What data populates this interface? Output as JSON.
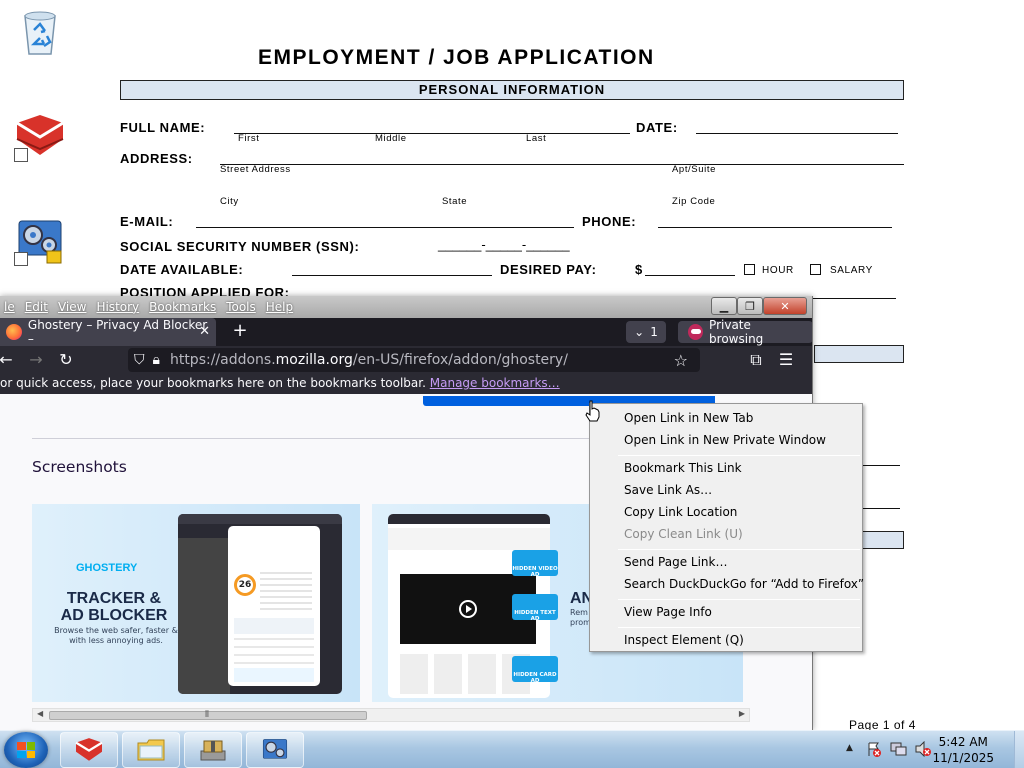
{
  "desktop": {
    "icons": [
      {
        "name": "recycle-bin"
      },
      {
        "name": "app-shortcut-red"
      },
      {
        "name": "settings-shortcut"
      }
    ]
  },
  "document": {
    "title": "EMPLOYMENT / JOB APPLICATION",
    "section": "PERSONAL INFORMATION",
    "full_name_label": "FULL NAME:",
    "first": "First",
    "middle": "Middle",
    "last": "Last",
    "date_label": "DATE:",
    "address_label": "ADDRESS:",
    "street": "Street Address",
    "apt": "Apt/Suite",
    "city": "City",
    "state": "State",
    "zip": "Zip Code",
    "email_label": "E-MAIL:",
    "phone_label": "PHONE:",
    "ssn_label": "SOCIAL SECURITY NUMBER (SSN):",
    "ssn_blank": "______-_____-______",
    "date_available_label": "DATE AVAILABLE:",
    "desired_pay_label": "DESIRED PAY:",
    "pay_prefix": "$",
    "hour": "HOUR",
    "salary": "SALARY",
    "position_label": "POSITION APPLIED FOR:",
    "page_indicator": "Page 1 of 4"
  },
  "firefox": {
    "menu": [
      "le",
      "Edit",
      "View",
      "History",
      "Bookmarks",
      "Tools",
      "Help"
    ],
    "tab_title": "Ghostery – Privacy Ad Blocker –",
    "tab_count": "1",
    "private_label": "Private browsing",
    "url_prefix": "https://addons.",
    "url_host": "mozilla.org",
    "url_path": "/en-US/firefox/addon/ghostery/",
    "bookmarks_text": "or quick access, place your bookmarks here on the bookmarks toolbar.",
    "manage_bookmarks": "Manage bookmarks…",
    "screenshots_heading": "Screenshots",
    "shot1": {
      "logo": "GHOSTERY",
      "title": "TRACKER & AD BLOCKER",
      "subtitle": "Browse the web safer, faster & with less annoying ads.",
      "score": "26"
    },
    "shot2": {
      "heading": "AN",
      "sub": "Rem\nprom",
      "tags": [
        "HIDDEN VIDEO AD",
        "HIDDEN TEXT AD",
        "HIDDEN CARD AD"
      ]
    }
  },
  "context_menu": {
    "items": [
      {
        "label": "Open Link in New Tab",
        "enabled": true
      },
      {
        "label": "Open Link in New Private Window",
        "enabled": true
      },
      {
        "label": "Bookmark This Link",
        "enabled": true
      },
      {
        "label": "Save Link As…",
        "enabled": true
      },
      {
        "label": "Copy Link Location",
        "enabled": true
      },
      {
        "label": "Copy Clean Link (U)",
        "enabled": false
      },
      {
        "label": "Send Page Link…",
        "enabled": true
      },
      {
        "label": "Search DuckDuckGo for “Add to Firefox”",
        "enabled": true
      },
      {
        "label": "View Page Info",
        "enabled": true
      },
      {
        "label": "Inspect Element (Q)",
        "enabled": true
      }
    ]
  },
  "taskbar": {
    "time": "5:42 AM",
    "date": "11/1/2025"
  },
  "colors": {
    "firefox_dark": "#1c1b22",
    "firefox_toolbar": "#2b2a33",
    "accent_blue": "#0060df",
    "bookmark_link": "#c59cf5",
    "form_band": "#dbe5f1"
  }
}
